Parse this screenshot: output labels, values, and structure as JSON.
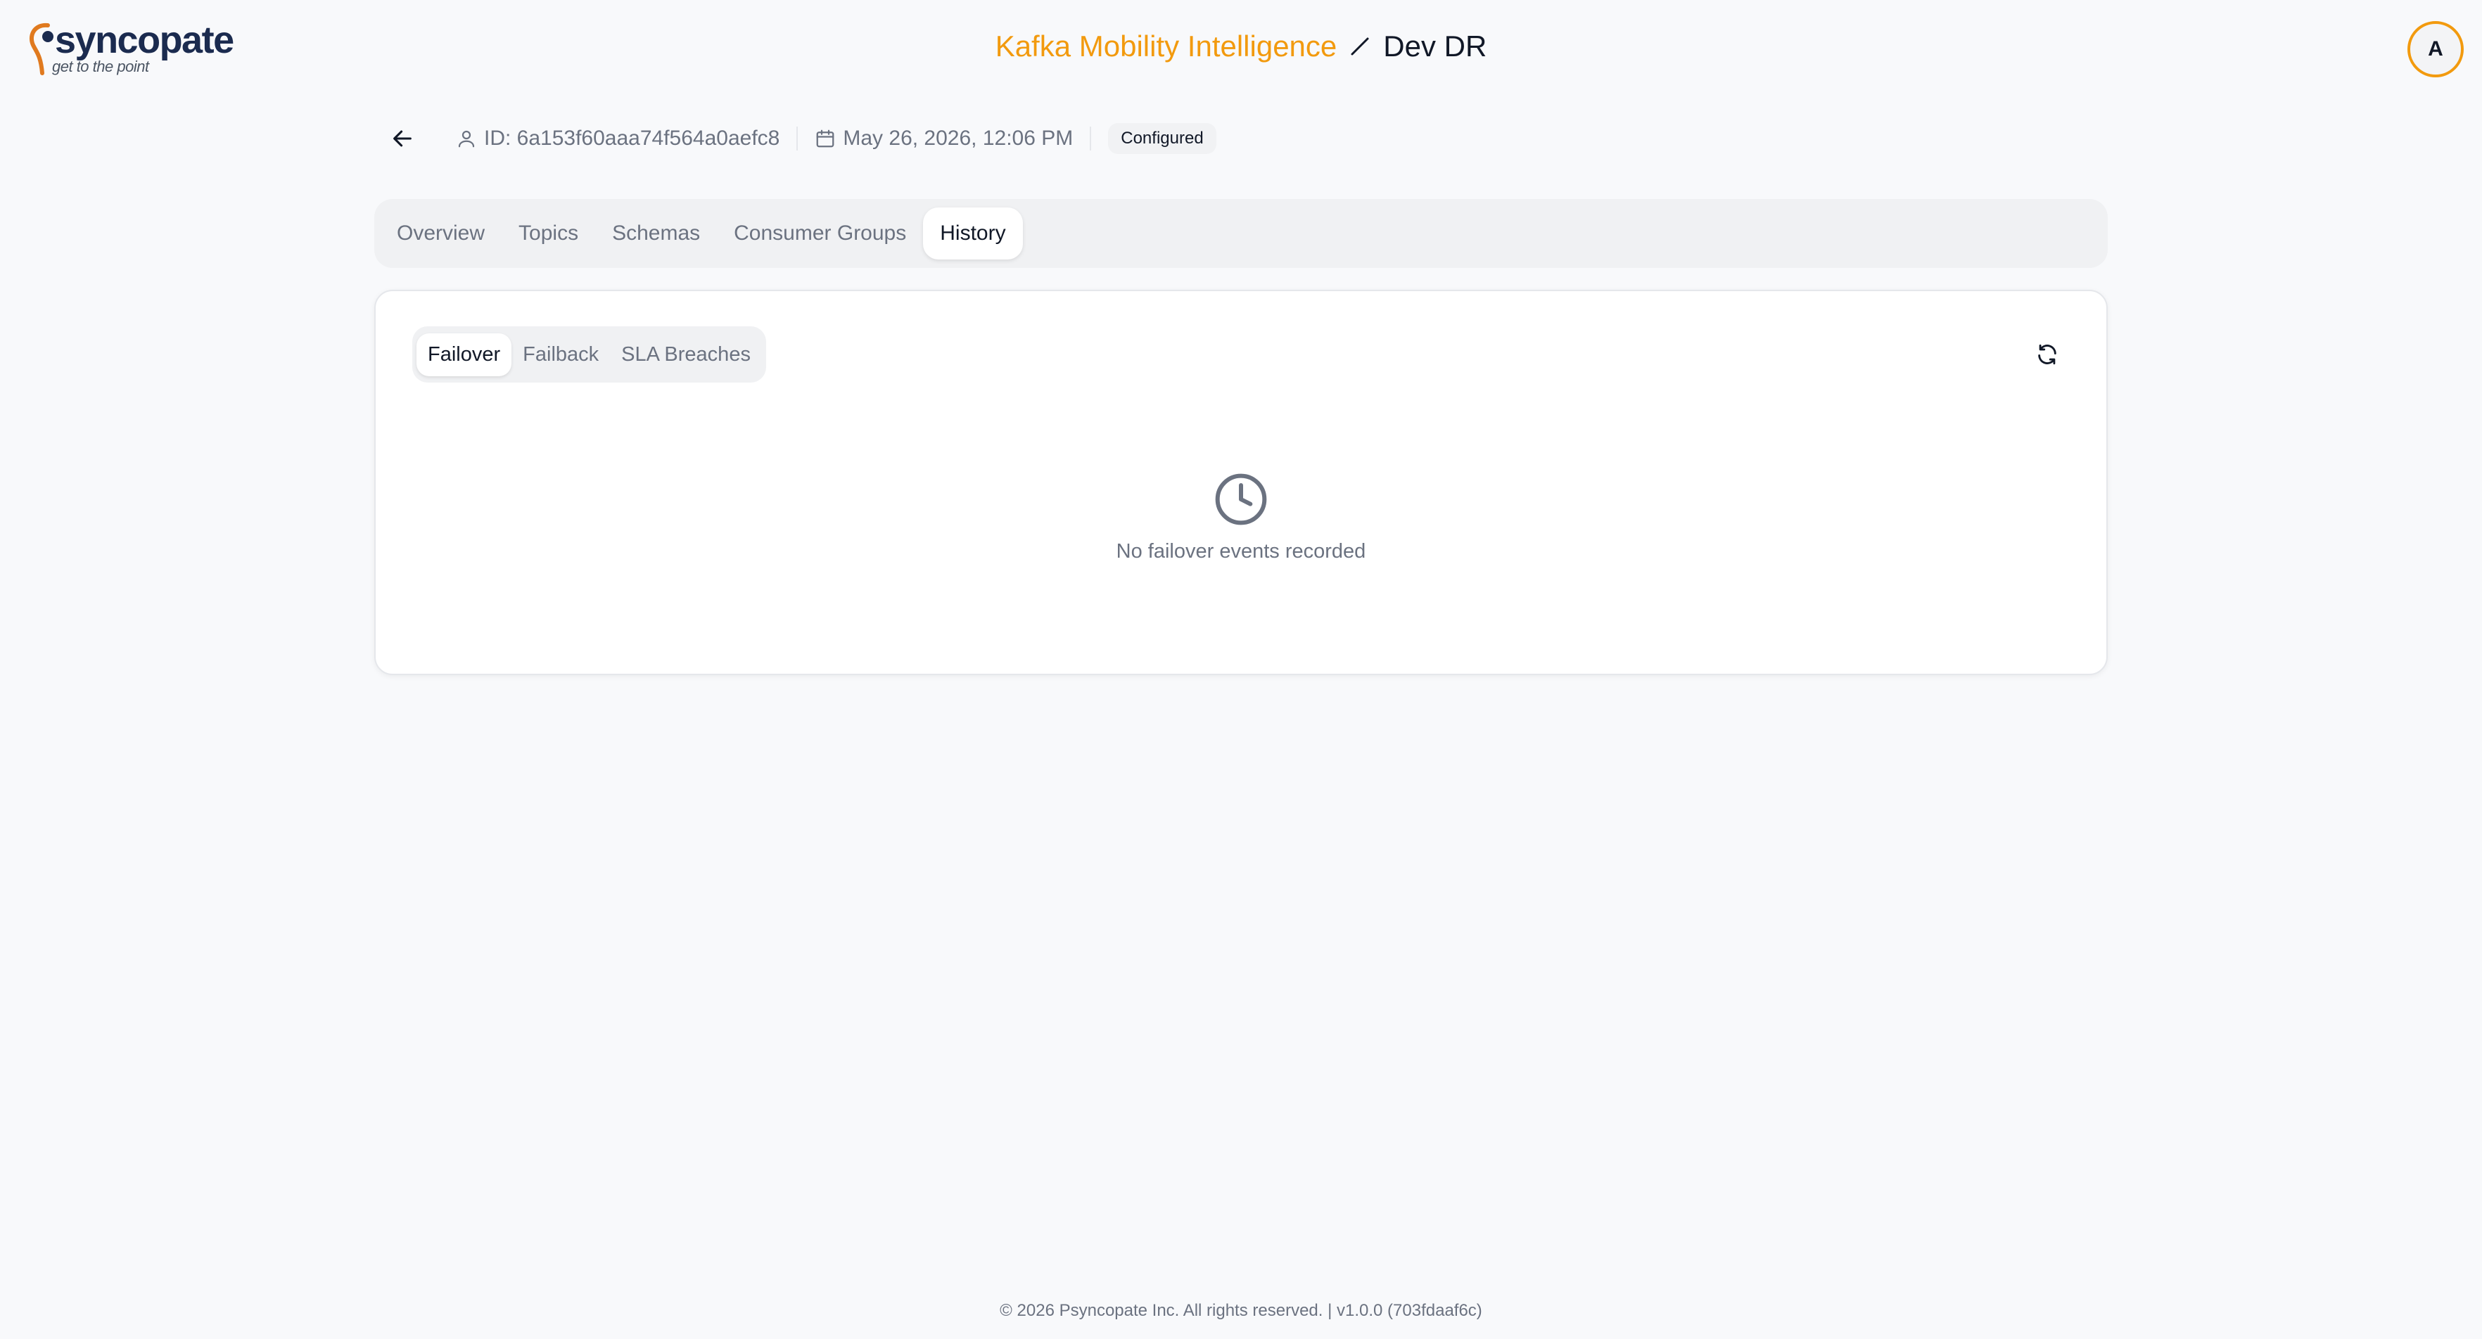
{
  "header": {
    "logo_word": "syncopate",
    "logo_tagline": "get to the point",
    "app_name": "Kafka Mobility Intelligence",
    "env_name": "Dev DR",
    "avatar_initial": "A",
    "accent_color": "#f29a0e"
  },
  "meta": {
    "id_text": "ID: 6a153f60aaa74f564a0aefc8",
    "date_text": "May 26, 2026, 12:06 PM",
    "status_badge": "Configured"
  },
  "tabs": [
    {
      "label": "Overview"
    },
    {
      "label": "Topics"
    },
    {
      "label": "Schemas"
    },
    {
      "label": "Consumer Groups"
    },
    {
      "label": "History"
    }
  ],
  "active_tab": "History",
  "history": {
    "subtabs": [
      {
        "label": "Failover"
      },
      {
        "label": "Failback"
      },
      {
        "label": "SLA Breaches"
      }
    ],
    "active_subtab": "Failover",
    "empty_message": "No failover events recorded"
  },
  "footer": {
    "text": "© 2026 Psyncopate Inc. All rights reserved. | v1.0.0 (703fdaaf6c)"
  }
}
